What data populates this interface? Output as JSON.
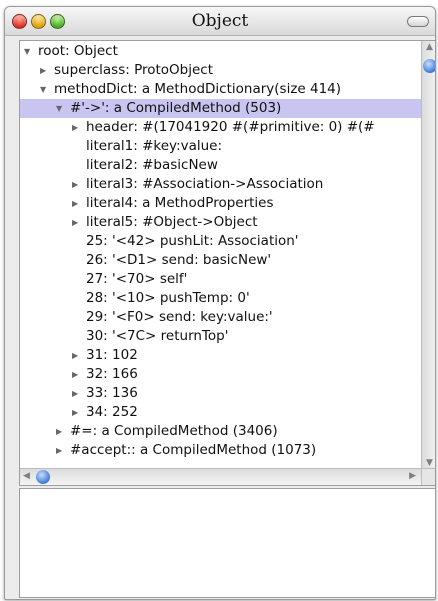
{
  "window": {
    "title": "Object"
  },
  "tree": {
    "rows": [
      {
        "depth": 0,
        "expander": "expanded",
        "text": "root: Object",
        "selected": false
      },
      {
        "depth": 1,
        "expander": "collapsed",
        "text": "superclass: ProtoObject",
        "selected": false
      },
      {
        "depth": 1,
        "expander": "expanded",
        "text": "methodDict: a MethodDictionary(size 414)",
        "selected": false
      },
      {
        "depth": 2,
        "expander": "expanded",
        "text": "#'->': a CompiledMethod (503)",
        "selected": true
      },
      {
        "depth": 3,
        "expander": "collapsed",
        "text": "header: #(17041920 #(#primitive: 0) #(#",
        "selected": false
      },
      {
        "depth": 3,
        "expander": "none",
        "text": "literal1: #key:value:",
        "selected": false
      },
      {
        "depth": 3,
        "expander": "none",
        "text": "literal2: #basicNew",
        "selected": false
      },
      {
        "depth": 3,
        "expander": "collapsed",
        "text": "literal3: #Association->Association",
        "selected": false
      },
      {
        "depth": 3,
        "expander": "collapsed",
        "text": "literal4: a MethodProperties",
        "selected": false
      },
      {
        "depth": 3,
        "expander": "collapsed",
        "text": "literal5: #Object->Object",
        "selected": false
      },
      {
        "depth": 3,
        "expander": "none",
        "text": "25: '<42> pushLit: Association'",
        "selected": false
      },
      {
        "depth": 3,
        "expander": "none",
        "text": "26: '<D1> send: basicNew'",
        "selected": false
      },
      {
        "depth": 3,
        "expander": "none",
        "text": "27: '<70> self'",
        "selected": false
      },
      {
        "depth": 3,
        "expander": "none",
        "text": "28: '<10> pushTemp: 0'",
        "selected": false
      },
      {
        "depth": 3,
        "expander": "none",
        "text": "29: '<F0> send: key:value:'",
        "selected": false
      },
      {
        "depth": 3,
        "expander": "none",
        "text": "30: '<7C> returnTop'",
        "selected": false
      },
      {
        "depth": 3,
        "expander": "collapsed",
        "text": "31: 102",
        "selected": false
      },
      {
        "depth": 3,
        "expander": "collapsed",
        "text": "32: 166",
        "selected": false
      },
      {
        "depth": 3,
        "expander": "collapsed",
        "text": "33: 136",
        "selected": false
      },
      {
        "depth": 3,
        "expander": "collapsed",
        "text": "34: 252",
        "selected": false
      },
      {
        "depth": 2,
        "expander": "collapsed",
        "text": "#=: a CompiledMethod (3406)",
        "selected": false
      },
      {
        "depth": 2,
        "expander": "collapsed",
        "text": "#accept:: a CompiledMethod (1073)",
        "selected": false
      }
    ]
  },
  "text_pane": {
    "content": ""
  }
}
